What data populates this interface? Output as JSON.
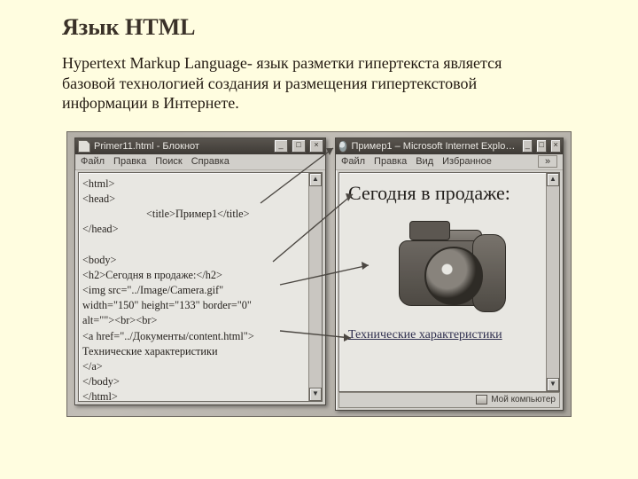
{
  "heading": "Язык HTML",
  "paragraph": " Hypertext  Markup Language- язык разметки гипертекста является базовой технологией создания и размещения гипертекстовой информации в Интернете.",
  "notepad": {
    "title": "Primer11.html - Блокнот",
    "menu": {
      "file": "Файл",
      "edit": "Правка",
      "search": "Поиск",
      "help": "Справка"
    },
    "code": {
      "l1": "<html>",
      "l2": "<head>",
      "l3": "<title>Пример1</title>",
      "l4": "</head>",
      "l5": "",
      "l6": "<body>",
      "l7": "<h2>Сегодня в продаже:</h2>",
      "l8": "<img src=\"../Image/Camera.gif\"",
      "l9": "width=\"150\" height=\"133\" border=\"0\"",
      "l10": "alt=\"\"><br><br>",
      "l11": "<a href=\"../Документы/content.html\">",
      "l12": "Технические характеристики",
      "l13": "</a>",
      "l14": "</body>",
      "l15": "</html>"
    }
  },
  "browser": {
    "title": "Пример1 – Microsoft Internet Explo…",
    "menu": {
      "file": "Файл",
      "edit": "Правка",
      "view": "Вид",
      "favorites": "Избранное",
      "more": "»"
    },
    "page": {
      "heading": "Сегодня в продаже:",
      "link": "Технические характеристики"
    },
    "status": "Мой компьютер"
  },
  "winbuttons": {
    "min": "_",
    "max": "□",
    "close": "×"
  },
  "scroll": {
    "up": "▲",
    "down": "▼"
  },
  "icons": {
    "doc": "doc-icon",
    "ie": "ie-icon",
    "pc": "pc-icon"
  }
}
